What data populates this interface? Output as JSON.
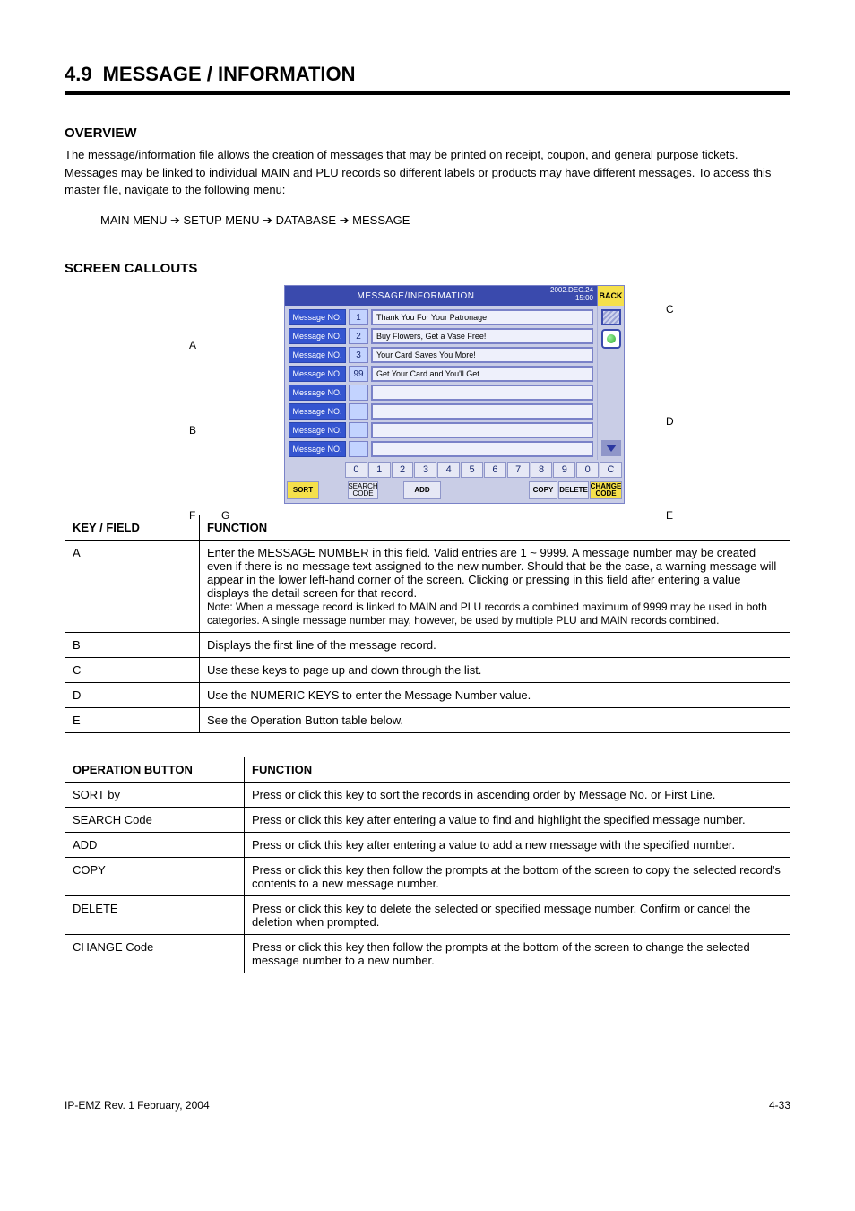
{
  "header": {
    "section_number": "4.9",
    "section_title": "MESSAGE / INFORMATION",
    "overview_heading": "OVERVIEW",
    "overview_body": "The message/information file allows the creation of messages that may be printed on receipt, coupon, and general purpose tickets. Messages may be linked to individual MAIN and PLU records so different labels or products may have different messages. To access this master file, navigate to the following menu:",
    "nav_path": "MAIN MENU  ➔  SETUP MENU  ➔  DATABASE  ➔  MESSAGE",
    "callouts_heading": "SCREEN CALLOUTS"
  },
  "callouts": {
    "a": "A",
    "b": "B",
    "c": "C",
    "d": "D",
    "e": "E",
    "f": "F",
    "g": "G"
  },
  "screenshot": {
    "title": "MESSAGE/INFORMATION",
    "date_line1": "2002.DEC.24",
    "date_line2": "15:00",
    "back": "BACK",
    "row_label": "Message NO.",
    "rows": [
      {
        "no": "1",
        "text": "Thank You For Your Patronage"
      },
      {
        "no": "2",
        "text": "Buy Flowers, Get a Vase Free!"
      },
      {
        "no": "3",
        "text": "Your Card Saves You More!"
      },
      {
        "no": "99",
        "text": "Get Your Card and You'll Get"
      },
      {
        "no": "",
        "text": ""
      },
      {
        "no": "",
        "text": ""
      },
      {
        "no": "",
        "text": ""
      },
      {
        "no": "",
        "text": ""
      }
    ],
    "numkeys": [
      "0",
      "1",
      "2",
      "3",
      "4",
      "5",
      "6",
      "7",
      "8",
      "9",
      "0",
      "C"
    ],
    "fn": {
      "sort": "SORT",
      "search": "SEARCH CODE",
      "add": "ADD",
      "copy": "COPY",
      "delete": "DELETE",
      "change": "CHANGE CODE"
    }
  },
  "table1": {
    "head_key": "KEY / FIELD",
    "head_fn": "FUNCTION",
    "rows": [
      {
        "k": "A",
        "v": "Enter the MESSAGE NUMBER in this field.  Valid entries are 1 ~ 9999.  A message number may be created even if there is no message text assigned to the new number.  Should that be the case, a warning message will appear in the lower left-hand corner of the screen.  Clicking or pressing in this field after entering a value displays the detail screen for that record.",
        "note": "Note: When a message record is linked to MAIN and PLU records a combined maximum of 9999 may be used in both categories.  A single message number may, however, be used by multiple PLU and MAIN records combined."
      },
      {
        "k": "B",
        "v": "Displays the first line of the message record."
      },
      {
        "k": "C",
        "v": "Use these keys to page up and down through the list."
      },
      {
        "k": "D",
        "v": "Use the NUMERIC KEYS to enter the Message Number value."
      },
      {
        "k": "E",
        "v": "See the Operation Button table below."
      }
    ]
  },
  "table2": {
    "head_key": "OPERATION BUTTON",
    "head_fn": "FUNCTION",
    "rows": [
      {
        "k": "SORT by",
        "v": "Press or click this key to sort the records in ascending order by Message No. or First Line."
      },
      {
        "k": "SEARCH Code",
        "v": "Press or click this key after entering a value to find and highlight the specified message number."
      },
      {
        "k": "ADD",
        "v": "Press or click this key after entering a value to add a new message with the specified number."
      },
      {
        "k": "COPY",
        "v": "Press or click this key then follow the prompts at the bottom of the screen to copy the selected record's contents to a new message number."
      },
      {
        "k": "DELETE",
        "v": "Press or click this key to delete the selected or specified message number.  Confirm or cancel the deletion when prompted."
      },
      {
        "k": "CHANGE Code",
        "v": "Press or click this key then follow the prompts at the bottom of the screen to change the selected message number to a new number."
      }
    ]
  },
  "footer": {
    "left": "IP-EMZ Rev. 1  February, 2004",
    "right": "4-33"
  }
}
